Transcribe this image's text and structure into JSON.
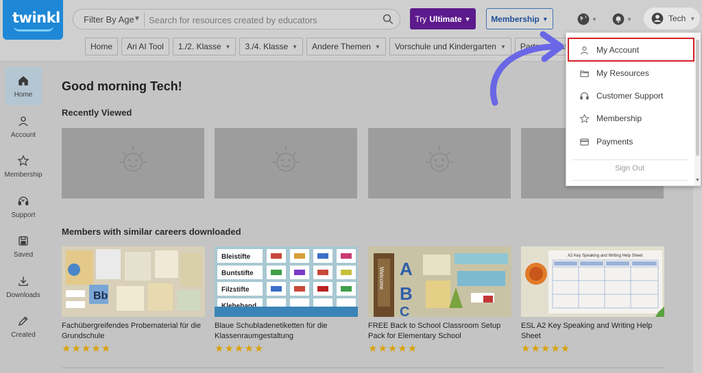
{
  "header": {
    "logo_text": "twinkl",
    "age_filter_label": "Filter By Age",
    "search_placeholder": "Search for resources created by educators",
    "try_ultimate": {
      "prefix": "Try",
      "label": "Ultimate"
    },
    "membership_label": "Membership",
    "user_name": "Tech"
  },
  "categories": [
    {
      "label": "Home",
      "has_caret": false
    },
    {
      "label": "Ari AI Tool",
      "has_caret": false
    },
    {
      "label": "1./2. Klasse",
      "has_caret": true
    },
    {
      "label": "3./4. Klasse",
      "has_caret": true
    },
    {
      "label": "Andere Themen",
      "has_caret": true
    },
    {
      "label": "Vorschule und Kindergarten",
      "has_caret": true
    },
    {
      "label": "Partnerschaft",
      "has_caret": false
    }
  ],
  "sidebar": {
    "items": [
      {
        "label": "Home",
        "icon": "home-icon",
        "active": true
      },
      {
        "label": "Account",
        "icon": "user-icon",
        "active": false
      },
      {
        "label": "Membership",
        "icon": "star-icon",
        "active": false
      },
      {
        "label": "Support",
        "icon": "headset-icon",
        "active": false
      },
      {
        "label": "Saved",
        "icon": "save-icon",
        "active": false
      },
      {
        "label": "Downloads",
        "icon": "download-icon",
        "active": false
      },
      {
        "label": "Created",
        "icon": "pencil-icon",
        "active": false
      }
    ]
  },
  "main": {
    "greeting": "Good morning Tech!",
    "recently_viewed_title": "Recently Viewed",
    "recently_viewed_count": 4,
    "similar_title": "Members with similar careers downloaded",
    "downloads": [
      {
        "title": "Fachübergreifendes Probematerial für die Grundschule",
        "rating": 5
      },
      {
        "title": "Blaue Schubladenetiketten für die Klassenraumgestaltung",
        "rating": 5
      },
      {
        "title": "FREE Back to School Classroom Setup Pack for Elementary School",
        "rating": 5
      },
      {
        "title": "ESL A2 Key Speaking and Writing Help Sheet",
        "rating": 5
      }
    ]
  },
  "thumb_text": {
    "t2_labels": [
      "Bleistifte",
      "Buntstifte",
      "Filzstifte",
      "Klebeband"
    ],
    "t3_letters": "ABC",
    "t3_welcome": "Welcome",
    "t4_heading": "A2 Key Speaking and Writing Help Sheet"
  },
  "dropdown": {
    "items": [
      {
        "label": "My Account",
        "icon": "user-icon",
        "highlighted": true
      },
      {
        "label": "My Resources",
        "icon": "folder-icon",
        "highlighted": false
      },
      {
        "label": "Customer Support",
        "icon": "headset-icon",
        "highlighted": false
      },
      {
        "label": "Membership",
        "icon": "star-icon",
        "highlighted": false
      },
      {
        "label": "Payments",
        "icon": "credit-card-icon",
        "highlighted": false
      }
    ],
    "sign_out": "Sign Out"
  },
  "colors": {
    "brand_blue": "#1e88d6",
    "ultimate_purple": "#5c1a8c",
    "highlight_red": "#d61f26",
    "annotation_arrow": "#6a67e6",
    "star_gold": "#d9a20e"
  }
}
